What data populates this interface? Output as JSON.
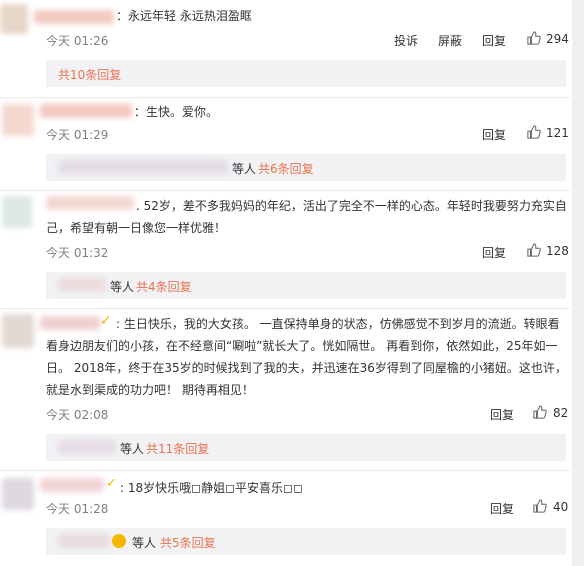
{
  "comments": [
    {
      "text": "：永远年轻  永远热泪盈眶",
      "time": "今天 01:26",
      "actions": {
        "report": "投诉",
        "block": "屏蔽",
        "reply": "回复"
      },
      "likes": "294",
      "reply_more": "共10条回复",
      "reply_suffix": ""
    },
    {
      "text": "：生快。爱你。",
      "time": "今天 01:29",
      "actions": {
        "reply": "回复"
      },
      "likes": "121",
      "reply_more": "共6条回复",
      "reply_suffix": "等人"
    },
    {
      "text_lines": [
        ". 52岁，差不多我妈妈的年纪，活出了完全不一样的心态。年轻时我要努力充实自",
        "己，希望有朝一日像您一样优雅！"
      ],
      "time": "今天 01:32",
      "actions": {
        "reply": "回复"
      },
      "likes": "128",
      "reply_more": "共4条回复",
      "reply_suffix": "等人"
    },
    {
      "text_lines": [
        ": 生日快乐，我的大女孩。 一直保持单身的状态，仿佛感觉不到岁月的流逝。转眼看",
        "看身边朋友们的小孩，在不经意间“唰啦”就长大了。恍如隔世。 再看到你，依然如此，25年如一",
        "日。 2018年，终于在35岁的时候找到了我的夫，并迅速在36岁得到了同屋檐的小猪妞。这也许，",
        "就是水到渠成的功力吧！ 期待再相见！"
      ],
      "time": "今天 02:08",
      "actions": {
        "reply": "回复"
      },
      "likes": "82",
      "reply_more": "共11条回复",
      "reply_suffix": "等人"
    },
    {
      "text": ": 18岁快乐哦◻静姐◻平安喜乐◻◻",
      "time": "今天 01:28",
      "actions": {
        "reply": "回复"
      },
      "likes": "40",
      "reply_more": "共5条回复",
      "reply_suffix": "等人"
    }
  ],
  "colors": {
    "link": "#eb7350",
    "reply_bg": "#f2f2f5",
    "time": "#808080"
  },
  "icons": {
    "like": "thumbs-up-icon",
    "verified": "verified-v-icon"
  }
}
